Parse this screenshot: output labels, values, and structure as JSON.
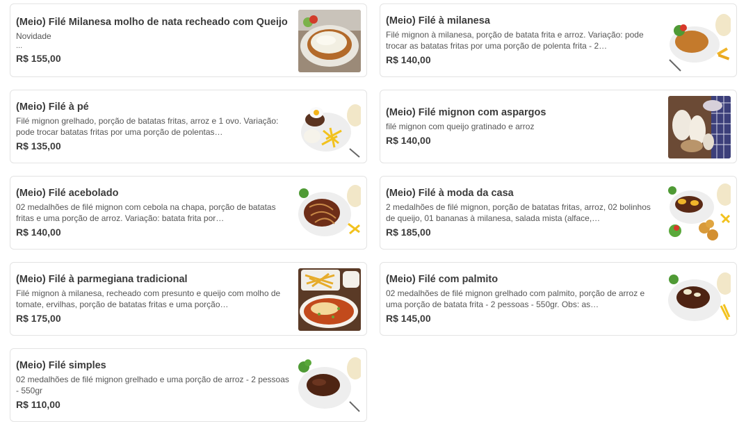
{
  "items": [
    {
      "title": "(Meio) Filé Milanesa molho de nata recheado com Queijo",
      "desc": "Novidade",
      "extra": "...",
      "price": "R$ 155,00",
      "image": "file-milanesa-nata-photo"
    },
    {
      "title": "(Meio) Filé à milanesa",
      "desc": "Filé mignon à milanesa, porção de batata frita e arroz. Variação: pode trocar as batatas fritas por uma porção de polenta frita - 2…",
      "price": "R$ 140,00",
      "image": "file-a-milanesa-photo"
    },
    {
      "title": "(Meio) Filé à pé",
      "desc": "Filé mignon grelhado, porção de batatas fritas, arroz e 1 ovo. Variação: pode trocar batatas fritas por uma porção de polentas…",
      "price": "R$ 135,00",
      "image": "file-a-pe-photo"
    },
    {
      "title": "(Meio) Filé mignon com aspargos",
      "desc": "filé mignon com queijo gratinado e arroz",
      "price": "R$ 140,00",
      "image": "file-aspargos-photo"
    },
    {
      "title": "(Meio) Filé acebolado",
      "desc": "02 medalhões de filé mignon com cebola na chapa, porção de batatas fritas e uma porção de arroz. Variação: batata frita por…",
      "price": "R$ 140,00",
      "image": "file-acebolado-photo"
    },
    {
      "title": "(Meio) Filé à moda da casa",
      "desc": "2 medalhões de filé mignon, porção de batatas fritas, arroz, 02 bolinhos de queijo, 01 bananas à milanesa, salada mista (alface,…",
      "price": "R$ 185,00",
      "image": "file-moda-da-casa-photo"
    },
    {
      "title": "(Meio) Filé à parmegiana tradicional",
      "desc": "Filé mignon à milanesa, recheado com presunto e queijo com molho de tomate, ervilhas, porção de batatas fritas e uma porção…",
      "price": "R$ 175,00",
      "image": "file-parmegiana-photo"
    },
    {
      "title": "(Meio) Filé com palmito",
      "desc": "02 medalhões de filé mignon grelhado com palmito, porção de arroz e uma porção de batata frita - 2 pessoas - 550gr. Obs: as…",
      "price": "R$ 145,00",
      "image": "file-palmito-photo"
    },
    {
      "title": "(Meio) Filé simples",
      "desc": "02 medalhões de filé mignon grelhado e uma porção de arroz - 2 pessoas - 550gr",
      "price": "R$ 110,00",
      "image": "file-simples-photo"
    }
  ]
}
